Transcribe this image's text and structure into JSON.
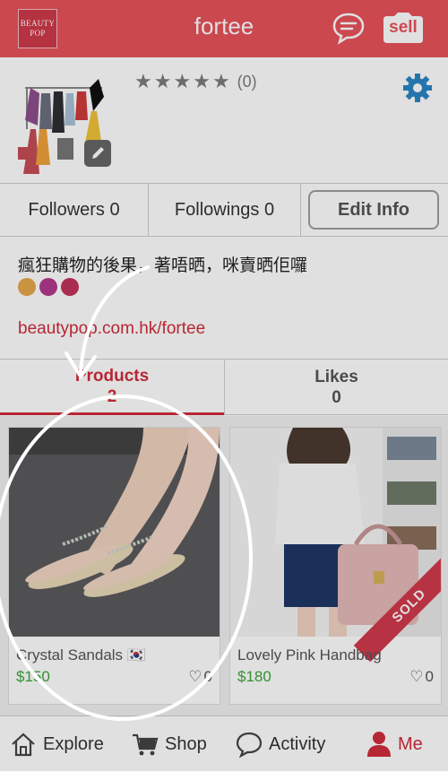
{
  "header": {
    "logo_line1": "BEAUTY",
    "logo_line2": "POP",
    "title": "fortee",
    "sell_label": "sell",
    "brand_color": "#e8535b"
  },
  "profile": {
    "rating_stars": 0,
    "rating_count": "(0)"
  },
  "stats": {
    "followers": "Followers 0",
    "followings": "Followings 0",
    "edit_info": "Edit Info"
  },
  "bio": {
    "text": "瘋狂購物的後果，著唔晒，咪賣晒佢囉",
    "link": "beautypop.com.hk/fortee"
  },
  "tabs": [
    {
      "label": "Products",
      "count": "2",
      "active": true
    },
    {
      "label": "Likes",
      "count": "0",
      "active": false
    }
  ],
  "products": [
    {
      "name": "Crystal Sandals 🇰🇷",
      "price": "$150",
      "likes": "0",
      "sold": false
    },
    {
      "name": "Lovely Pink Handbag",
      "price": "$180",
      "likes": "0",
      "sold": true,
      "sold_label": "SOLD"
    }
  ],
  "bottom_nav": [
    {
      "label": "Explore",
      "icon": "home-icon"
    },
    {
      "label": "Shop",
      "icon": "cart-icon"
    },
    {
      "label": "Activity",
      "icon": "chat-icon"
    },
    {
      "label": "Me",
      "icon": "person-icon",
      "active": true
    }
  ],
  "colors": {
    "accent": "#d12c3c",
    "price": "#3aa63a"
  }
}
